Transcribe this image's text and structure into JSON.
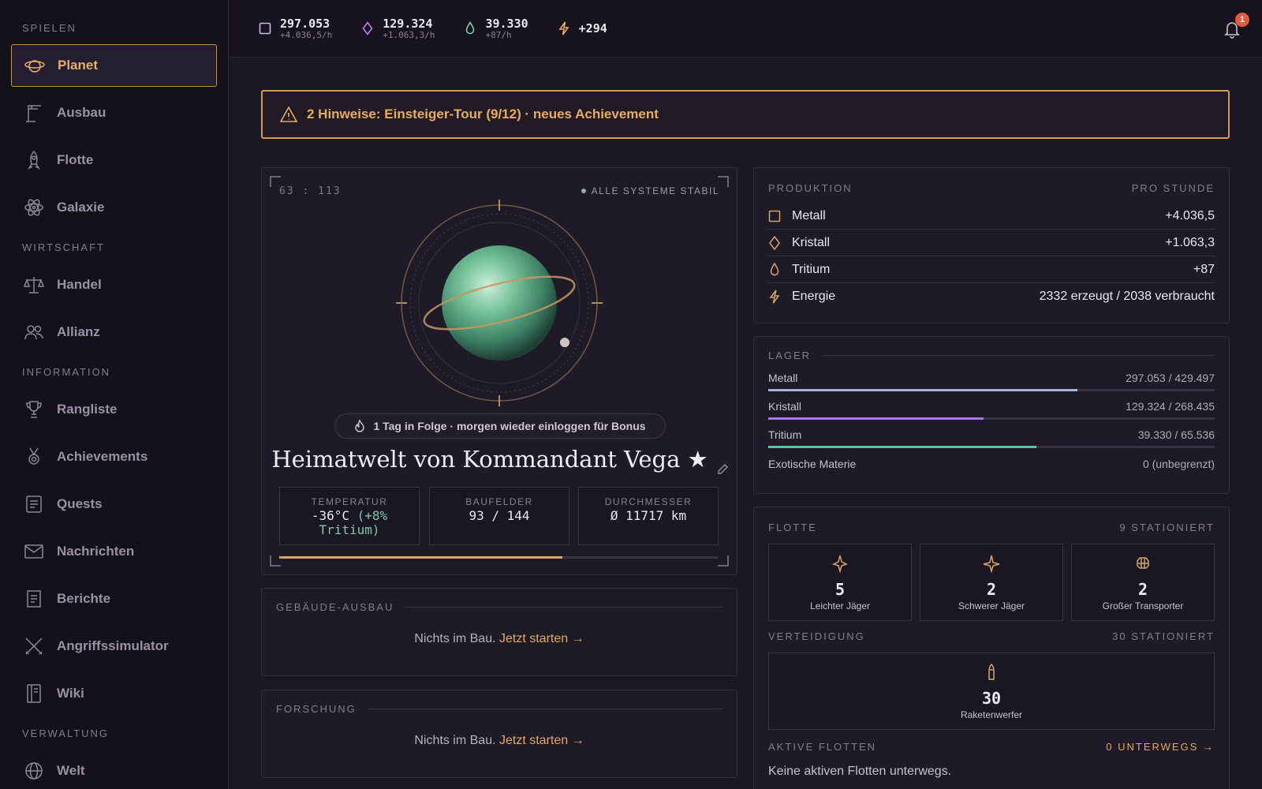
{
  "sidebar": {
    "sections": [
      {
        "title": "SPIELEN",
        "items": [
          {
            "label": "Planet",
            "icon": "planet-icon",
            "active": true
          },
          {
            "label": "Ausbau",
            "icon": "crane-icon"
          },
          {
            "label": "Flotte",
            "icon": "rocket-icon"
          },
          {
            "label": "Galaxie",
            "icon": "atom-icon"
          }
        ]
      },
      {
        "title": "WIRTSCHAFT",
        "items": [
          {
            "label": "Handel",
            "icon": "scales-icon"
          },
          {
            "label": "Allianz",
            "icon": "users-icon"
          }
        ]
      },
      {
        "title": "INFORMATION",
        "items": [
          {
            "label": "Rangliste",
            "icon": "trophy-icon"
          },
          {
            "label": "Achievements",
            "icon": "medal-icon"
          },
          {
            "label": "Quests",
            "icon": "quest-list-icon"
          },
          {
            "label": "Nachrichten",
            "icon": "mail-icon"
          },
          {
            "label": "Berichte",
            "icon": "report-icon"
          },
          {
            "label": "Angriffssimulator",
            "icon": "swords-icon"
          },
          {
            "label": "Wiki",
            "icon": "book-icon"
          }
        ]
      },
      {
        "title": "VERWALTUNG",
        "items": [
          {
            "label": "Welt",
            "icon": "globe-icon"
          }
        ]
      }
    ]
  },
  "topbar": {
    "resources": [
      {
        "value": "297.053",
        "rate": "+4.036,5/h",
        "icon": "metal-icon",
        "color": "#b8c0e0"
      },
      {
        "value": "129.324",
        "rate": "+1.063,3/h",
        "icon": "crystal-icon",
        "color": "#b884f0"
      },
      {
        "value": "39.330",
        "rate": "+87/h",
        "icon": "tritium-icon",
        "color": "#6fd1b0"
      },
      {
        "value": "+294",
        "rate": "",
        "icon": "energy-icon",
        "color": "#e6b06a"
      }
    ],
    "notifications": "1"
  },
  "alert": {
    "text": "2 Hinweise: Einsteiger-Tour (9/12) · neues Achievement"
  },
  "planet": {
    "coords": "63 : 113",
    "status": "ALLE SYSTEME STABIL",
    "streak": "1 Tag in Folge · morgen wieder einloggen für Bonus",
    "name": "Heimatwelt von Kommandant Vega ★",
    "stats": [
      {
        "label": "TEMPERATUR",
        "value": "-36°C",
        "extra": "(+8% Tritium)"
      },
      {
        "label": "BAUFELDER",
        "value": "93 / 144",
        "extra": ""
      },
      {
        "label": "DURCHMESSER",
        "value": "Ø 11717 km",
        "extra": ""
      }
    ],
    "fields_progress": 0.646
  },
  "building": {
    "title": "GEBÄUDE-AUSBAU",
    "empty": "Nichts im Bau.",
    "link": "Jetzt starten →"
  },
  "research": {
    "title": "FORSCHUNG",
    "empty": "Nichts im Bau.",
    "link": "Jetzt starten →"
  },
  "production": {
    "title": "PRODUKTION",
    "unit": "PRO STUNDE",
    "rows": [
      {
        "label": "Metall",
        "value": "+4.036,5",
        "icon": "metal-icon"
      },
      {
        "label": "Kristall",
        "value": "+1.063,3",
        "icon": "crystal-icon"
      },
      {
        "label": "Tritium",
        "value": "+87",
        "icon": "tritium-icon"
      },
      {
        "label": "Energie",
        "value": "2332 erzeugt / 2038 verbraucht",
        "icon": "energy-icon"
      }
    ]
  },
  "storage": {
    "title": "LAGER",
    "rows": [
      {
        "label": "Metall",
        "value": "297.053 / 429.497",
        "fill": 0.692,
        "color": "#a9b2d8"
      },
      {
        "label": "Kristall",
        "value": "129.324 / 268.435",
        "fill": 0.482,
        "color": "#a978e6"
      },
      {
        "label": "Tritium",
        "value": "39.330 / 65.536",
        "fill": 0.6,
        "color": "#5cc79f"
      }
    ],
    "exotic": {
      "label": "Exotische Materie",
      "value": "0 (unbegrenzt)"
    }
  },
  "fleet": {
    "title": "FLOTTE",
    "count": "9 STATIONIERT",
    "units": [
      {
        "count": "5",
        "name": "Leichter Jäger",
        "icon": "light-fighter-icon"
      },
      {
        "count": "2",
        "name": "Schwerer Jäger",
        "icon": "heavy-fighter-icon"
      },
      {
        "count": "2",
        "name": "Großer Transporter",
        "icon": "transporter-icon"
      }
    ],
    "defense_title": "VERTEIDIGUNG",
    "defense_count": "30 STATIONIERT",
    "defense": {
      "count": "30",
      "name": "Raketenwerfer",
      "icon": "rocket-launcher-icon"
    },
    "active_title": "AKTIVE FLOTTEN",
    "active_link": "0 UNTERWEGS →",
    "active_empty": "Keine aktiven Flotten unterwegs."
  }
}
